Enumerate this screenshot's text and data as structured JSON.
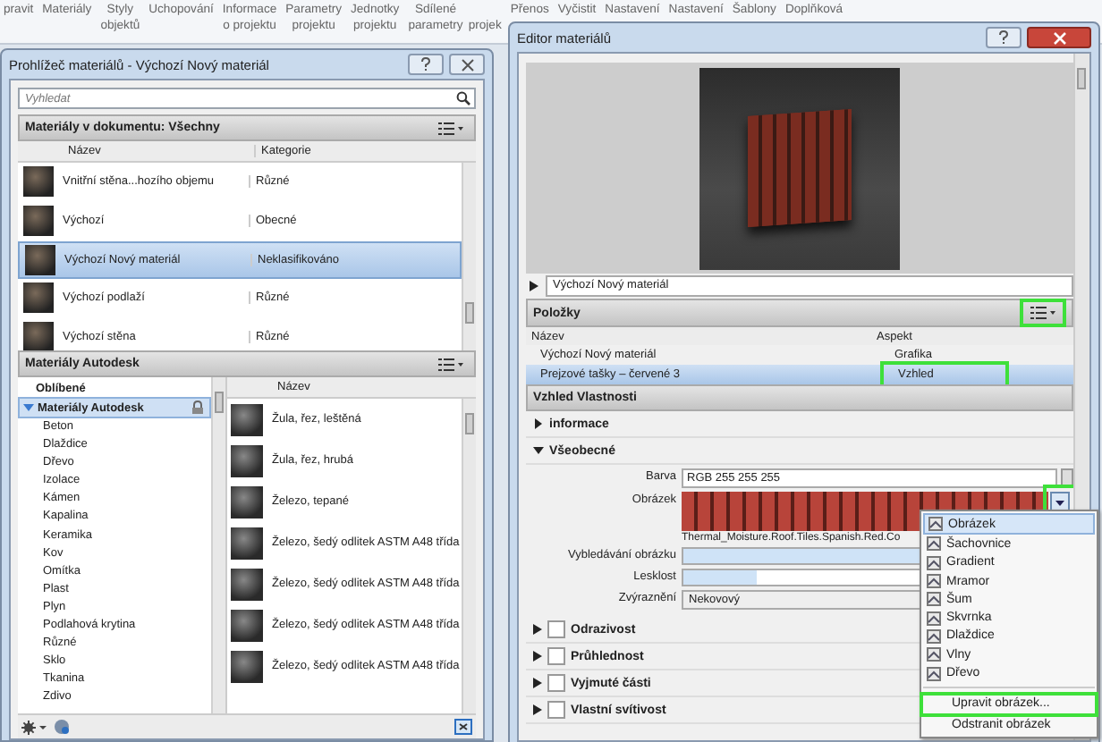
{
  "ribbon": {
    "groups": [
      {
        "lines": [
          "pravit"
        ]
      },
      {
        "lines": [
          "Materiály"
        ]
      },
      {
        "lines": [
          "Styly",
          "objektů"
        ]
      },
      {
        "lines": [
          "Uchopování"
        ]
      },
      {
        "lines": [
          "Informace",
          "o projektu"
        ]
      },
      {
        "lines": [
          "Parametry",
          "projektu"
        ]
      },
      {
        "lines": [
          "Jednotky",
          "projektu"
        ]
      },
      {
        "lines": [
          "Sdílené",
          "parametry"
        ]
      },
      {
        "lines": [
          "projek"
        ],
        "lower": true
      },
      {
        "lines": [
          "Přenos"
        ]
      },
      {
        "lines": [
          "Vyčistit"
        ]
      },
      {
        "lines": [
          "Nastavení"
        ]
      },
      {
        "lines": [
          "Nastavení"
        ]
      },
      {
        "lines": [
          "Šablony"
        ]
      },
      {
        "lines": [
          "Doplňková"
        ]
      }
    ]
  },
  "browser": {
    "title": "Prohlížeč materiálů - Výchozí Nový materiál",
    "search": {
      "placeholder": "Vyhledat"
    },
    "document_section": {
      "title": "Materiály v dokumentu: Všechny",
      "columns": [
        "Název",
        "Kategorie"
      ],
      "rows": [
        {
          "name": "Vnitřní stěna...hozího objemu",
          "category": "Různé",
          "selected": false
        },
        {
          "name": "Výchozí",
          "category": "Obecné",
          "selected": false
        },
        {
          "name": "Výchozí Nový materiál",
          "category": "Neklasifikováno",
          "selected": true
        },
        {
          "name": "Výchozí podlaží",
          "category": "Různé",
          "selected": false
        },
        {
          "name": "Výchozí stěna",
          "category": "Různé",
          "selected": false
        }
      ]
    },
    "library_section": {
      "title": "Materiály Autodesk",
      "tree": [
        {
          "label": "Oblíbené",
          "selected": false
        },
        {
          "label": "Materiály Autodesk",
          "selected": true,
          "expanded": true,
          "children": [
            {
              "label": "Beton"
            },
            {
              "label": "Dlaždice"
            },
            {
              "label": "Dřevo"
            },
            {
              "label": "Izolace"
            },
            {
              "label": "Kámen"
            },
            {
              "label": "Kapalina"
            },
            {
              "label": "Keramika"
            },
            {
              "label": "Kov"
            },
            {
              "label": "Omítka"
            },
            {
              "label": "Plast"
            },
            {
              "label": "Plyn"
            },
            {
              "label": "Podlahová krytina"
            },
            {
              "label": "Různé"
            },
            {
              "label": "Sklo"
            },
            {
              "label": "Tkanina"
            },
            {
              "label": "Zdivo"
            }
          ]
        }
      ],
      "list_column": "Název",
      "list": [
        "Žula, řez, leštěná",
        "Žula, řez, hrubá",
        "Železo, tepané",
        "Železo, šedý odlitek ASTM A48 třída",
        "Železo, šedý odlitek ASTM A48 třída",
        "Železo, šedý odlitek ASTM A48 třída",
        "Železo, šedý odlitek ASTM A48 třída"
      ]
    }
  },
  "editor": {
    "title": "Editor materiálů",
    "material_name": "Výchozí Nový materiál",
    "items_section": {
      "title": "Položky",
      "list_button_highlighted": true,
      "columns": [
        "Název",
        "Aspekt"
      ],
      "rows": [
        {
          "name": "Výchozí Nový materiál",
          "aspect": "Grafika",
          "selected": false,
          "highlighted": false
        },
        {
          "name": "Prejzové tašky – červené 3",
          "aspect": "Vzhled",
          "selected": true,
          "highlighted": true
        }
      ]
    },
    "properties_title": "Vzhled Vlastnosti",
    "groups": [
      {
        "label": "informace",
        "expanded": false
      },
      {
        "label": "Všeobecné",
        "expanded": true
      }
    ],
    "fields": [
      {
        "kind": "text",
        "label": "Barva",
        "value": "RGB 255 255 255"
      },
      {
        "kind": "image",
        "label": "Obrázek",
        "caption": "Thermal_Moisture.Roof.Tiles.Spanish.Red.Co",
        "button_highlighted": true
      },
      {
        "kind": "slider",
        "label": "Vybledávání obrázku",
        "level": 1
      },
      {
        "kind": "slider",
        "label": "Lesklost",
        "level": 0.2
      },
      {
        "kind": "select",
        "label": "Zvýraznění",
        "value": "Nekovový"
      }
    ],
    "optional_groups": [
      {
        "label": "Odrazivost",
        "checked": false
      },
      {
        "label": "Průhlednost",
        "checked": false
      },
      {
        "label": "Vyjmuté části",
        "checked": false
      },
      {
        "label": "Vlastní svítivost",
        "checked": false
      }
    ],
    "menu": {
      "items": [
        {
          "label": "Obrázek",
          "selected": true
        },
        {
          "label": "Šachovnice",
          "selected": false
        },
        {
          "label": "Gradient",
          "selected": false
        },
        {
          "label": "Mramor",
          "selected": false
        },
        {
          "label": "Šum",
          "selected": false
        },
        {
          "label": "Skvrnka",
          "selected": false
        },
        {
          "label": "Dlaždice",
          "selected": false
        },
        {
          "label": "Vlny",
          "selected": false
        },
        {
          "label": "Dřevo",
          "selected": false
        }
      ],
      "actions": [
        {
          "label": "Upravit obrázek...",
          "highlighted": true
        },
        {
          "label": "Odstranit obrázek",
          "highlighted": false
        }
      ]
    }
  }
}
